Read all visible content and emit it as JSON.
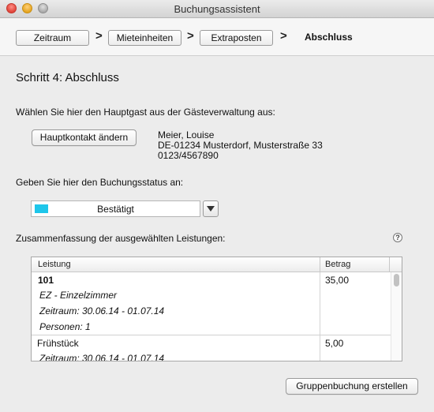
{
  "window": {
    "title": "Buchungsassistent"
  },
  "steps": {
    "items": [
      {
        "label": "Zeitraum"
      },
      {
        "label": "Mieteinheiten"
      },
      {
        "label": "Extraposten"
      }
    ],
    "separator": ">",
    "current": "Abschluss"
  },
  "main": {
    "heading": "Schritt 4: Abschluss",
    "guest_prompt": "Wählen Sie hier den Hauptgast aus der Gästeverwaltung aus:",
    "change_contact_button": "Hauptkontakt ändern",
    "guest": {
      "name": "Meier, Louise",
      "address": "DE-01234 Musterdorf, Musterstraße 33",
      "phone": "0123/4567890"
    },
    "status_prompt": "Geben Sie hier den Buchungsstatus an:",
    "status": {
      "value": "Bestätigt",
      "color": "#1ec6ea"
    },
    "summary_prompt": "Zusammenfassung der ausgewählten Leistungen:",
    "help_icon": "?",
    "table": {
      "columns": [
        "Leistung",
        "Betrag"
      ],
      "rows": [
        {
          "title": "101",
          "amount": "35,00",
          "details": [
            "EZ - Einzelzimmer",
            "Zeitraum: 30.06.14 - 01.07.14",
            "Personen: 1"
          ]
        },
        {
          "title": "Frühstück",
          "amount": "5,00",
          "details": [
            "Zeitraum: 30.06.14 - 01.07.14"
          ]
        }
      ]
    },
    "create_group_button": "Gruppenbuchung erstellen"
  }
}
